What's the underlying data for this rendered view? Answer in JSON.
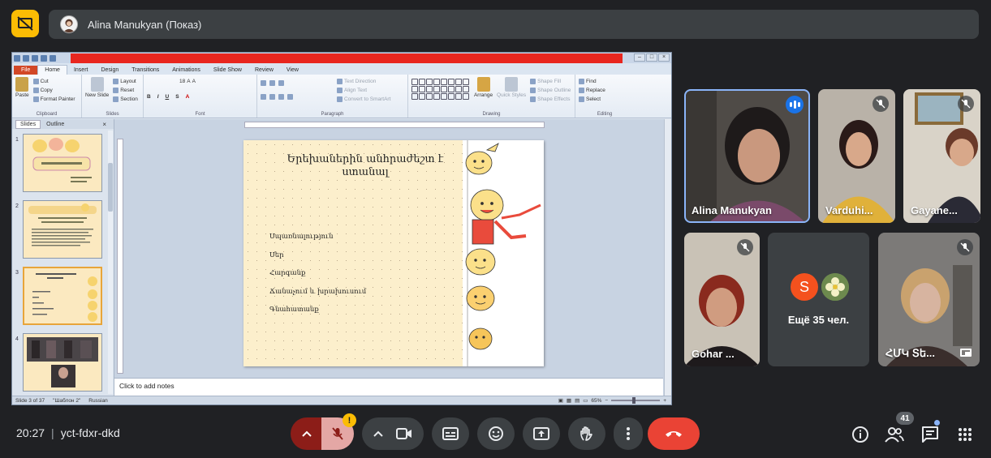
{
  "meet": {
    "presenter_label": "Alina Manukyan (Показ)",
    "time": "20:27",
    "meeting_code": "yct-fdxr-dkd",
    "people_count": "41",
    "warning_badge": "!"
  },
  "ppt": {
    "tabs": [
      "File",
      "Home",
      "Insert",
      "Design",
      "Transitions",
      "Animations",
      "Slide Show",
      "Review",
      "View"
    ],
    "ribbon": {
      "paste": "Paste",
      "cut": "Cut",
      "copy": "Copy",
      "format_painter": "Format Painter",
      "clipboard": "Clipboard",
      "new_slide": "New Slide",
      "layout": "Layout",
      "reset": "Reset",
      "section": "Section",
      "slides": "Slides",
      "font": "Font",
      "font_size": "18",
      "paragraph": "Paragraph",
      "text_direction": "Text Direction",
      "align_text": "Align Text",
      "convert_smartart": "Convert to SmartArt",
      "arrange": "Arrange",
      "quick_styles": "Quick Styles",
      "shape_fill": "Shape Fill",
      "shape_outline": "Shape Outline",
      "shape_effects": "Shape Effects",
      "drawing": "Drawing",
      "find": "Find",
      "replace": "Replace",
      "select": "Select",
      "editing": "Editing"
    },
    "panel_tabs": {
      "slides": "Slides",
      "outline": "Outline"
    },
    "thumb_numbers": [
      "1",
      "2",
      "3",
      "4"
    ],
    "slide_title": "Երեխաներին անհրաժեշտ է ստանալ",
    "slide_items": [
      "Սպառնալություն",
      "Սեր",
      "Հարգանք",
      "Ճանաչում և խրախուսում",
      "Գնահատանք"
    ],
    "notes_placeholder": "Click to add notes",
    "status": {
      "slide_of": "Slide 3 of 37",
      "theme": "\"Шаблон 2\"",
      "language": "Russian",
      "zoom": "65%"
    }
  },
  "tiles": [
    {
      "name": "Alina Manukyan",
      "state": "speaking"
    },
    {
      "name": "Varduhi...",
      "state": "muted"
    },
    {
      "name": "Gayane...",
      "state": "muted"
    },
    {
      "name": "Gohar ...",
      "state": "muted"
    },
    {
      "name": "ՀՄԿ Տե...",
      "state": "muted"
    }
  ],
  "more": {
    "avatar_letter": "S",
    "label": "Ещё 35 чел."
  },
  "colors": {
    "accent": "#8ab4f8",
    "end_call": "#ea4335",
    "present_toggle": "#fbbc04",
    "ppt_file_tab": "#d24726"
  },
  "icons": [
    "present-off-icon",
    "chevron-up-icon",
    "mic-off-icon",
    "camera-icon",
    "captions-icon",
    "emoji-icon",
    "present-screen-icon",
    "raise-hand-icon",
    "more-vert-icon",
    "call-end-icon",
    "info-icon",
    "people-icon",
    "chat-icon",
    "apps-grid-icon"
  ]
}
